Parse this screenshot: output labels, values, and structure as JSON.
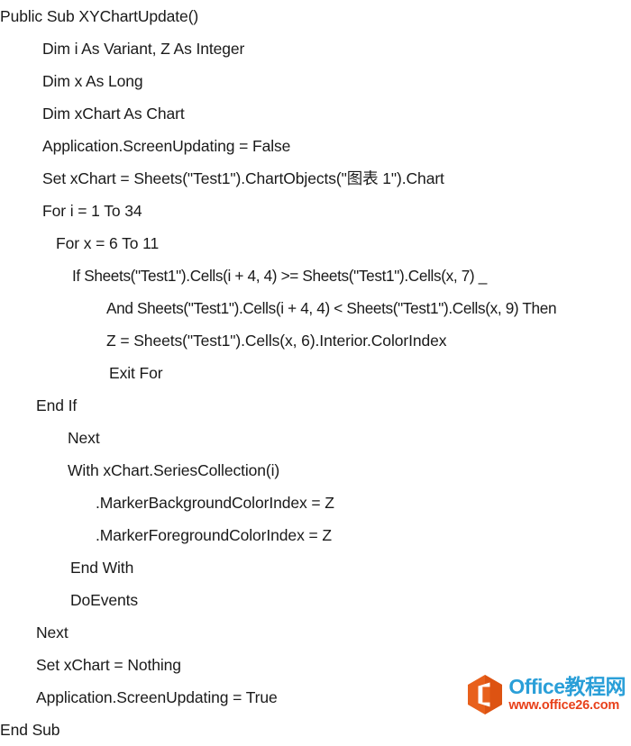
{
  "document": {
    "kind": "vba-code-snippet",
    "background_color": "#ffffff",
    "text_color": "#1a1a1a"
  },
  "code": {
    "language": "VBA",
    "lines": [
      {
        "indent": 0,
        "text": "Public Sub XYChartUpdate()"
      },
      {
        "indent": 3,
        "text": "Dim i As Variant, Z As Integer"
      },
      {
        "indent": 3,
        "text": "Dim x As Long"
      },
      {
        "indent": 3,
        "text": "Dim xChart As Chart"
      },
      {
        "indent": 3,
        "text": "Application.ScreenUpdating = False"
      },
      {
        "indent": 3,
        "text": "Set xChart = Sheets(\"Test1\").ChartObjects(\"图表 1\").Chart"
      },
      {
        "indent": 3,
        "text": "For i = 1 To 34"
      },
      {
        "indent": 4,
        "text": "For x = 6 To 11"
      },
      {
        "indent": 7,
        "text": "If Sheets(\"Test1\").Cells(i + 4, 4) >= Sheets(\"Test1\").Cells(x, 7) _"
      },
      {
        "indent": 9,
        "text": "And Sheets(\"Test1\").Cells(i + 4, 4) < Sheets(\"Test1\").Cells(x, 9) Then"
      },
      {
        "indent": 9,
        "text": "Z = Sheets(\"Test1\").Cells(x, 6).Interior.ColorIndex"
      },
      {
        "indent": 10,
        "text": "Exit For"
      },
      {
        "indent": 2,
        "text": "End If"
      },
      {
        "indent": 5,
        "text": "Next"
      },
      {
        "indent": 5,
        "text": "With xChart.SeriesCollection(i)"
      },
      {
        "indent": 8,
        "text": ".MarkerBackgroundColorIndex = Z"
      },
      {
        "indent": 8,
        "text": ".MarkerForegroundColorIndex = Z"
      },
      {
        "indent": 6,
        "text": "End With"
      },
      {
        "indent": 6,
        "text": "DoEvents"
      },
      {
        "indent": 2,
        "text": "Next"
      },
      {
        "indent": 2,
        "text": "Set xChart = Nothing"
      },
      {
        "indent": 2,
        "text": "Application.ScreenUpdating = True"
      },
      {
        "indent": 0,
        "text": "End Sub"
      }
    ]
  },
  "watermark": {
    "logo_icon": "office-hexagon-logo-icon",
    "site_name": "Office教程网",
    "site_url": "www.office26.com",
    "hexagon_color": "#e8601c",
    "hexagon_color_dark": "#d04a10",
    "title_color": "#2a9fd8",
    "url_color": "#e8401a"
  }
}
